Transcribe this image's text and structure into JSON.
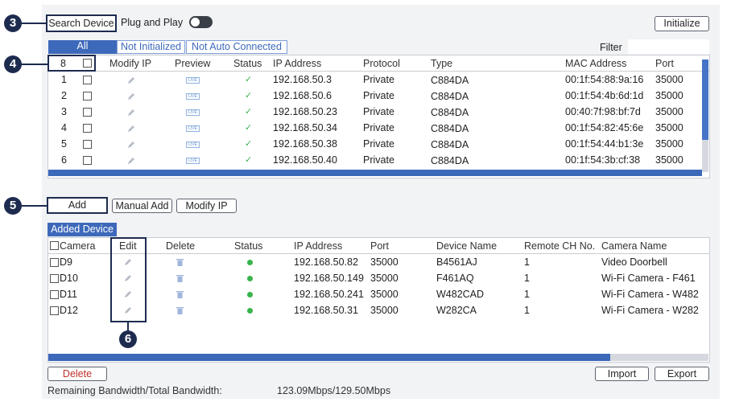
{
  "callouts": {
    "c3": "3",
    "c4": "4",
    "c5": "5",
    "c6": "6"
  },
  "toolbar": {
    "search_device": "Search Device",
    "plug_and_play": "Plug and Play",
    "plug_and_play_on": false,
    "initialize": "Initialize",
    "filter_label": "Filter"
  },
  "tabs": [
    "All",
    "Not Initialized",
    "Not Auto Connected"
  ],
  "search_table": {
    "count": "8",
    "headers": {
      "modify_ip": "Modify IP",
      "preview": "Preview",
      "status": "Status",
      "ip": "IP Address",
      "protocol": "Protocol",
      "type": "Type",
      "mac": "MAC Address",
      "port": "Port"
    },
    "preview_badge": "LIVE",
    "status_icon": "check-icon",
    "rows": [
      {
        "no": "1",
        "ip": "192.168.50.3",
        "protocol": "Private",
        "type": "C884DA",
        "mac": "00:1f:54:88:9a:16",
        "port": "35000"
      },
      {
        "no": "2",
        "ip": "192.168.50.6",
        "protocol": "Private",
        "type": "C884DA",
        "mac": "00:1f:54:4b:6d:1d",
        "port": "35000"
      },
      {
        "no": "3",
        "ip": "192.168.50.23",
        "protocol": "Private",
        "type": "C884DA",
        "mac": "00:40:7f:98:bf:7d",
        "port": "35000"
      },
      {
        "no": "4",
        "ip": "192.168.50.34",
        "protocol": "Private",
        "type": "C884DA",
        "mac": "00:1f:54:82:45:6e",
        "port": "35000"
      },
      {
        "no": "5",
        "ip": "192.168.50.38",
        "protocol": "Private",
        "type": "C884DA",
        "mac": "00:1f:54:44:b1:3e",
        "port": "35000"
      },
      {
        "no": "6",
        "ip": "192.168.50.40",
        "protocol": "Private",
        "type": "C884DA",
        "mac": "00:1f:54:3b:cf:38",
        "port": "35000"
      }
    ]
  },
  "actions": {
    "add": "Add",
    "manual_add": "Manual Add",
    "modify_ip": "Modify IP"
  },
  "added_device": {
    "title": "Added Device",
    "headers": {
      "camera": "Camera",
      "edit": "Edit",
      "delete": "Delete",
      "status": "Status",
      "ip": "IP Address",
      "port": "Port",
      "device_name": "Device Name",
      "remote_ch": "Remote CH No.",
      "camera_name": "Camera Name"
    },
    "rows": [
      {
        "camera": "D9",
        "ip": "192.168.50.82",
        "port": "35000",
        "device_name": "B4561AJ",
        "remote_ch": "1",
        "camera_name": "Video Doorbell"
      },
      {
        "camera": "D10",
        "ip": "192.168.50.149",
        "port": "35000",
        "device_name": "F461AQ",
        "remote_ch": "1",
        "camera_name": "Wi-Fi Camera - F461"
      },
      {
        "camera": "D11",
        "ip": "192.168.50.241",
        "port": "35000",
        "device_name": "W482CAD",
        "remote_ch": "1",
        "camera_name": "Wi-Fi Camera - W482"
      },
      {
        "camera": "D12",
        "ip": "192.168.50.31",
        "port": "35000",
        "device_name": "W282CA",
        "remote_ch": "1",
        "camera_name": "Wi-Fi Camera - W282"
      }
    ]
  },
  "bottom": {
    "delete": "Delete",
    "import": "Import",
    "export": "Export",
    "bandwidth_label": "Remaining Bandwidth/Total Bandwidth:",
    "bandwidth_value": "123.09Mbps/129.50Mbps"
  },
  "colors": {
    "accent": "#3d69ba",
    "callout": "#1d2b4f",
    "status_ok": "#37b34a",
    "delete_text": "#c0302a"
  }
}
